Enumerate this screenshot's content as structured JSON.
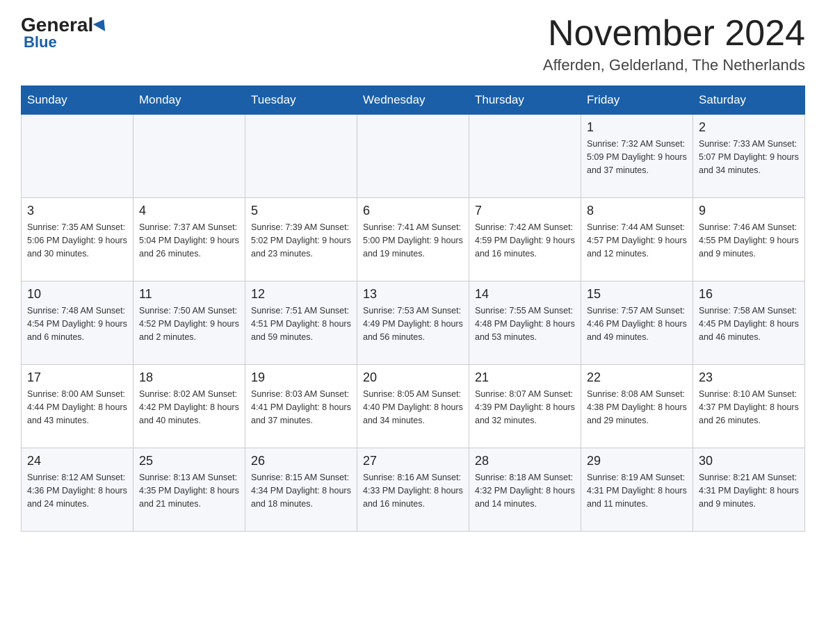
{
  "header": {
    "logo_general": "General",
    "logo_blue": "Blue",
    "month_title": "November 2024",
    "location": "Afferden, Gelderland, The Netherlands"
  },
  "columns": [
    "Sunday",
    "Monday",
    "Tuesday",
    "Wednesday",
    "Thursday",
    "Friday",
    "Saturday"
  ],
  "weeks": [
    [
      {
        "day": "",
        "info": ""
      },
      {
        "day": "",
        "info": ""
      },
      {
        "day": "",
        "info": ""
      },
      {
        "day": "",
        "info": ""
      },
      {
        "day": "",
        "info": ""
      },
      {
        "day": "1",
        "info": "Sunrise: 7:32 AM\nSunset: 5:09 PM\nDaylight: 9 hours\nand 37 minutes."
      },
      {
        "day": "2",
        "info": "Sunrise: 7:33 AM\nSunset: 5:07 PM\nDaylight: 9 hours\nand 34 minutes."
      }
    ],
    [
      {
        "day": "3",
        "info": "Sunrise: 7:35 AM\nSunset: 5:06 PM\nDaylight: 9 hours\nand 30 minutes."
      },
      {
        "day": "4",
        "info": "Sunrise: 7:37 AM\nSunset: 5:04 PM\nDaylight: 9 hours\nand 26 minutes."
      },
      {
        "day": "5",
        "info": "Sunrise: 7:39 AM\nSunset: 5:02 PM\nDaylight: 9 hours\nand 23 minutes."
      },
      {
        "day": "6",
        "info": "Sunrise: 7:41 AM\nSunset: 5:00 PM\nDaylight: 9 hours\nand 19 minutes."
      },
      {
        "day": "7",
        "info": "Sunrise: 7:42 AM\nSunset: 4:59 PM\nDaylight: 9 hours\nand 16 minutes."
      },
      {
        "day": "8",
        "info": "Sunrise: 7:44 AM\nSunset: 4:57 PM\nDaylight: 9 hours\nand 12 minutes."
      },
      {
        "day": "9",
        "info": "Sunrise: 7:46 AM\nSunset: 4:55 PM\nDaylight: 9 hours\nand 9 minutes."
      }
    ],
    [
      {
        "day": "10",
        "info": "Sunrise: 7:48 AM\nSunset: 4:54 PM\nDaylight: 9 hours\nand 6 minutes."
      },
      {
        "day": "11",
        "info": "Sunrise: 7:50 AM\nSunset: 4:52 PM\nDaylight: 9 hours\nand 2 minutes."
      },
      {
        "day": "12",
        "info": "Sunrise: 7:51 AM\nSunset: 4:51 PM\nDaylight: 8 hours\nand 59 minutes."
      },
      {
        "day": "13",
        "info": "Sunrise: 7:53 AM\nSunset: 4:49 PM\nDaylight: 8 hours\nand 56 minutes."
      },
      {
        "day": "14",
        "info": "Sunrise: 7:55 AM\nSunset: 4:48 PM\nDaylight: 8 hours\nand 53 minutes."
      },
      {
        "day": "15",
        "info": "Sunrise: 7:57 AM\nSunset: 4:46 PM\nDaylight: 8 hours\nand 49 minutes."
      },
      {
        "day": "16",
        "info": "Sunrise: 7:58 AM\nSunset: 4:45 PM\nDaylight: 8 hours\nand 46 minutes."
      }
    ],
    [
      {
        "day": "17",
        "info": "Sunrise: 8:00 AM\nSunset: 4:44 PM\nDaylight: 8 hours\nand 43 minutes."
      },
      {
        "day": "18",
        "info": "Sunrise: 8:02 AM\nSunset: 4:42 PM\nDaylight: 8 hours\nand 40 minutes."
      },
      {
        "day": "19",
        "info": "Sunrise: 8:03 AM\nSunset: 4:41 PM\nDaylight: 8 hours\nand 37 minutes."
      },
      {
        "day": "20",
        "info": "Sunrise: 8:05 AM\nSunset: 4:40 PM\nDaylight: 8 hours\nand 34 minutes."
      },
      {
        "day": "21",
        "info": "Sunrise: 8:07 AM\nSunset: 4:39 PM\nDaylight: 8 hours\nand 32 minutes."
      },
      {
        "day": "22",
        "info": "Sunrise: 8:08 AM\nSunset: 4:38 PM\nDaylight: 8 hours\nand 29 minutes."
      },
      {
        "day": "23",
        "info": "Sunrise: 8:10 AM\nSunset: 4:37 PM\nDaylight: 8 hours\nand 26 minutes."
      }
    ],
    [
      {
        "day": "24",
        "info": "Sunrise: 8:12 AM\nSunset: 4:36 PM\nDaylight: 8 hours\nand 24 minutes."
      },
      {
        "day": "25",
        "info": "Sunrise: 8:13 AM\nSunset: 4:35 PM\nDaylight: 8 hours\nand 21 minutes."
      },
      {
        "day": "26",
        "info": "Sunrise: 8:15 AM\nSunset: 4:34 PM\nDaylight: 8 hours\nand 18 minutes."
      },
      {
        "day": "27",
        "info": "Sunrise: 8:16 AM\nSunset: 4:33 PM\nDaylight: 8 hours\nand 16 minutes."
      },
      {
        "day": "28",
        "info": "Sunrise: 8:18 AM\nSunset: 4:32 PM\nDaylight: 8 hours\nand 14 minutes."
      },
      {
        "day": "29",
        "info": "Sunrise: 8:19 AM\nSunset: 4:31 PM\nDaylight: 8 hours\nand 11 minutes."
      },
      {
        "day": "30",
        "info": "Sunrise: 8:21 AM\nSunset: 4:31 PM\nDaylight: 8 hours\nand 9 minutes."
      }
    ]
  ]
}
